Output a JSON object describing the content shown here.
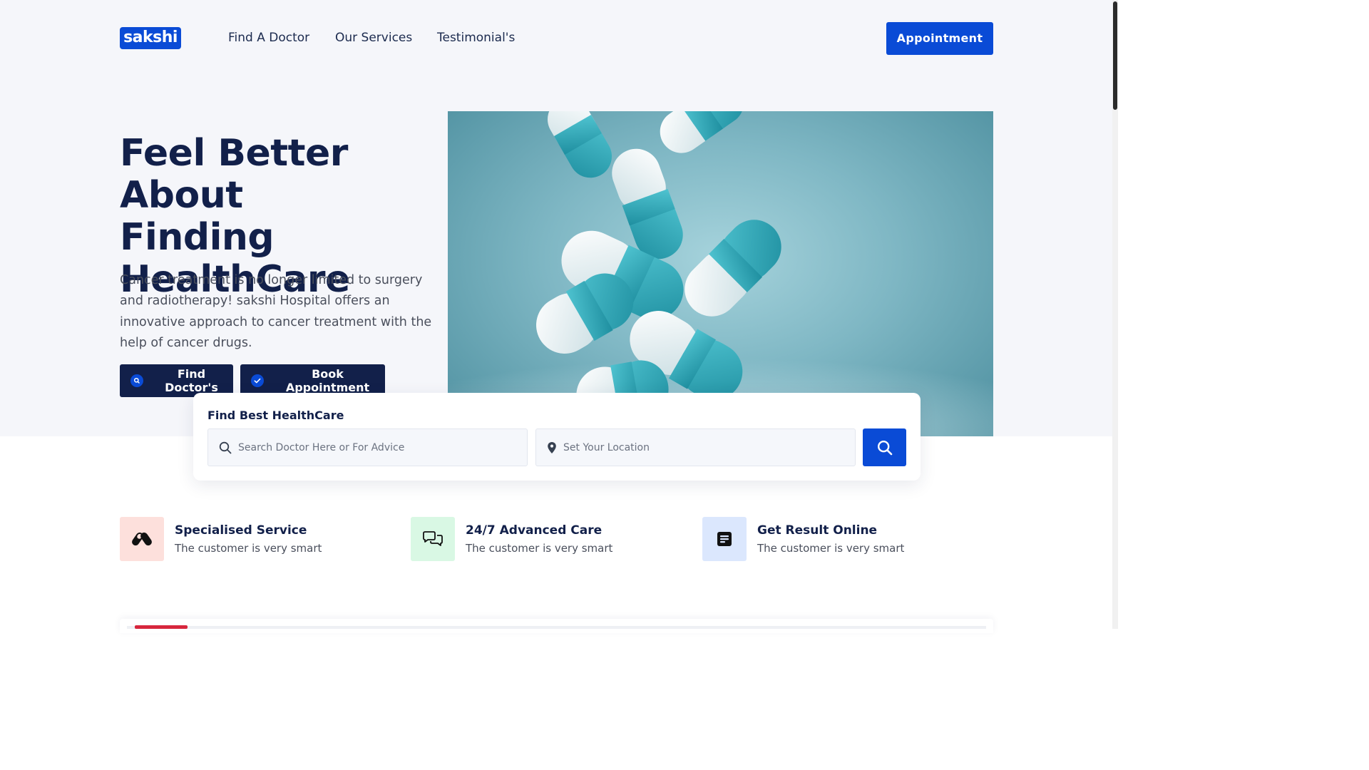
{
  "header": {
    "logo": "sakshi",
    "nav": [
      "Find A Doctor",
      "Our Services",
      "Testimonial's"
    ],
    "cta": "Appointment"
  },
  "hero": {
    "title_lines": [
      "Feel Better About",
      "Finding",
      "HealthCare"
    ],
    "description": "Cancer treatment is no longer limited to surgery and radiotherapy! sakshi Hospital offers an innovative approach to cancer treatment with the help of cancer drugs.",
    "buttons": {
      "find": "Find Doctor's",
      "book": "Book Appointment"
    }
  },
  "search": {
    "title": "Find Best HealthCare",
    "doctor_placeholder": "Search Doctor Here or For Advice",
    "location_placeholder": "Set Your Location"
  },
  "features": [
    {
      "title": "Specialised Service",
      "subtitle": "The customer is very smart",
      "icon": "pills-icon",
      "bg": "#fde0dc"
    },
    {
      "title": "24/7 Advanced Care",
      "subtitle": "The customer is very smart",
      "icon": "chat-icon",
      "bg": "#d9f8e4"
    },
    {
      "title": "Get Result Online",
      "subtitle": "The customer is very smart",
      "icon": "document-icon",
      "bg": "#dbe7fd"
    }
  ],
  "colors": {
    "primary": "#0a4bd6",
    "dark": "#12204a",
    "accent_red": "#d7263d"
  }
}
